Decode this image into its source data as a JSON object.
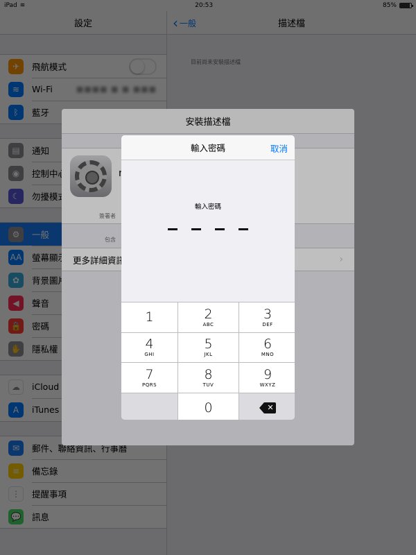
{
  "status": {
    "device": "iPad",
    "time": "20:53",
    "battery": "85%",
    "battery_level": 0.85
  },
  "left": {
    "title": "設定",
    "groups": [
      [
        {
          "label": "飛航模式",
          "icon": "airplane-icon",
          "color": "#ff9500",
          "glyph": "✈"
        },
        {
          "label": "Wi-Fi",
          "icon": "wifi-icon",
          "color": "#007aff",
          "glyph": "≋",
          "value": "■■■■ ■ ■ ■■■"
        },
        {
          "label": "藍牙",
          "icon": "bluetooth-icon",
          "color": "#007aff",
          "glyph": "ᛒ"
        }
      ],
      [
        {
          "label": "通知",
          "icon": "notifications-icon",
          "color": "#8e8e93",
          "glyph": "▤"
        },
        {
          "label": "控制中心",
          "icon": "control-center-icon",
          "color": "#8e8e93",
          "glyph": "◉"
        },
        {
          "label": "勿擾模式",
          "icon": "moon-icon",
          "color": "#5856d6",
          "glyph": "☾"
        }
      ],
      [
        {
          "label": "一般",
          "icon": "gear-icon",
          "color": "#8e8e93",
          "glyph": "⚙"
        },
        {
          "label": "螢幕顯示",
          "icon": "display-icon",
          "color": "#007aff",
          "glyph": "AA"
        },
        {
          "label": "背景圖片",
          "icon": "wallpaper-icon",
          "color": "#34aadc",
          "glyph": "✿"
        },
        {
          "label": "聲音",
          "icon": "sound-icon",
          "color": "#ff2d55",
          "glyph": "◀"
        },
        {
          "label": "密碼",
          "icon": "lock-icon",
          "color": "#ff3b30",
          "glyph": "🔒"
        },
        {
          "label": "隱私權",
          "icon": "hand-icon",
          "color": "#8e8e93",
          "glyph": "✋"
        }
      ],
      [
        {
          "label": "iCloud",
          "icon": "cloud-icon",
          "color": "#ffffff",
          "glyph": "☁"
        },
        {
          "label": "iTunes",
          "icon": "app-store-icon",
          "color": "#007aff",
          "glyph": "A"
        }
      ],
      [
        {
          "label": "郵件、聯絡資訊、行事曆",
          "icon": "mail-icon",
          "color": "#1a7cf7",
          "glyph": "✉"
        },
        {
          "label": "備忘錄",
          "icon": "notes-icon",
          "color": "#ffcc00",
          "glyph": "≡"
        },
        {
          "label": "提醒事項",
          "icon": "reminders-icon",
          "color": "#ffffff",
          "glyph": "⋮"
        },
        {
          "label": "訊息",
          "icon": "messages-icon",
          "color": "#4cd964",
          "glyph": "💬"
        }
      ]
    ]
  },
  "right": {
    "back": "一般",
    "title": "描述檔",
    "empty_text": "目前尚未安裝描述檔"
  },
  "sheet": {
    "title": "安裝描述檔",
    "profile_name": "n",
    "signer_label": "簽署者",
    "contains_label": "包含",
    "more_details": "更多詳細資訊"
  },
  "passcode": {
    "title": "輸入密碼",
    "cancel": "取消",
    "prompt": "輸入密碼",
    "keys": [
      {
        "num": "1",
        "letters": ""
      },
      {
        "num": "2",
        "letters": "ABC"
      },
      {
        "num": "3",
        "letters": "DEF"
      },
      {
        "num": "4",
        "letters": "GHI"
      },
      {
        "num": "5",
        "letters": "JKL"
      },
      {
        "num": "6",
        "letters": "MNO"
      },
      {
        "num": "7",
        "letters": "PQRS"
      },
      {
        "num": "8",
        "letters": "TUV"
      },
      {
        "num": "9",
        "letters": "WXYZ"
      },
      {
        "num": "",
        "letters": "",
        "type": "blank"
      },
      {
        "num": "0",
        "letters": ""
      },
      {
        "num": "",
        "letters": "",
        "type": "delete"
      }
    ]
  },
  "colors": {
    "accent": "#007aff",
    "selected": "#1a7cf7"
  }
}
